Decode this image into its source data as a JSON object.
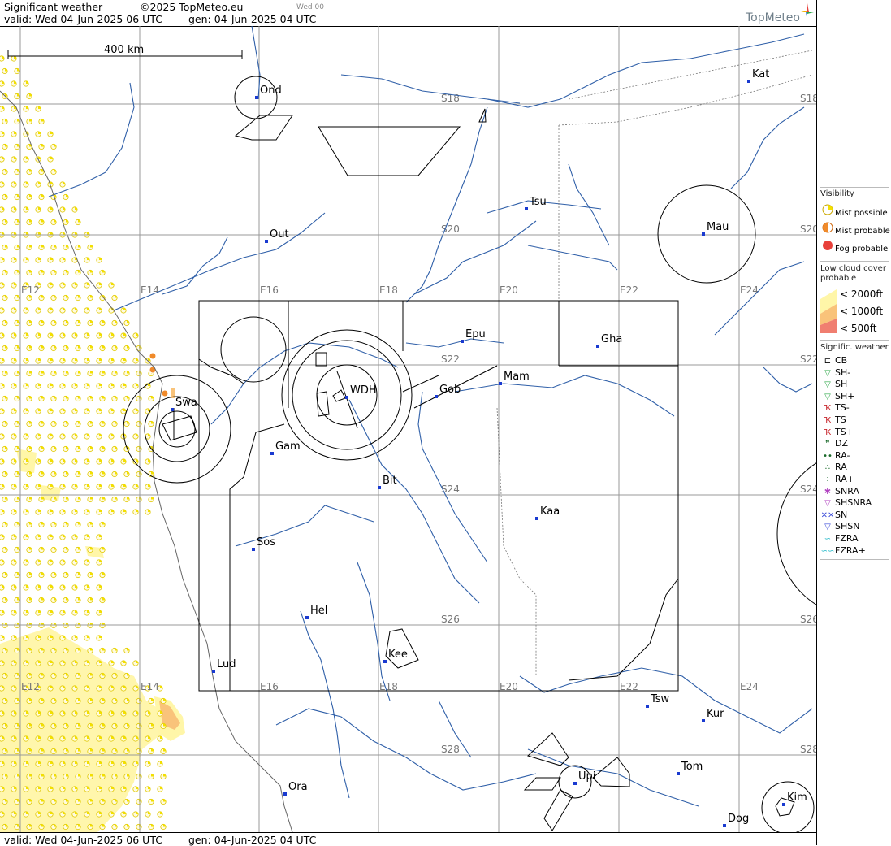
{
  "header": {
    "product": "Significant weather",
    "copyright": "©2025 TopMeteo.eu",
    "day_code": "Wed 00",
    "valid": "valid:  Wed  04-Jun-2025  06 UTC",
    "generated": "gen: 04-Jun-2025 04 UTC",
    "brand": "TopMeteo"
  },
  "footer": {
    "valid": "valid:  Wed  04-Jun-2025  06 UTC",
    "generated": "gen: 04-Jun-2025 04 UTC"
  },
  "map": {
    "scale_label": "400 km",
    "lat_labels": [
      "S18",
      "S20",
      "S22",
      "S24",
      "S26",
      "S28"
    ],
    "lon_labels": [
      "E12",
      "E14",
      "E16",
      "E18",
      "E20",
      "E22",
      "E24"
    ],
    "cities": [
      {
        "code": "Ond"
      },
      {
        "code": "Kat"
      },
      {
        "code": "Tsu"
      },
      {
        "code": "Out"
      },
      {
        "code": "Mau"
      },
      {
        "code": "Epu"
      },
      {
        "code": "Gha"
      },
      {
        "code": "Mam"
      },
      {
        "code": "Gob"
      },
      {
        "code": "WDH"
      },
      {
        "code": "Swa"
      },
      {
        "code": "Gam"
      },
      {
        "code": "Bit"
      },
      {
        "code": "Kaa"
      },
      {
        "code": "Sos"
      },
      {
        "code": "Hel"
      },
      {
        "code": "Kee"
      },
      {
        "code": "Lud"
      },
      {
        "code": "Tsw"
      },
      {
        "code": "Kur"
      },
      {
        "code": "Tom"
      },
      {
        "code": "Upi"
      },
      {
        "code": "Ora"
      },
      {
        "code": "Kim"
      },
      {
        "code": "Dog"
      }
    ]
  },
  "legend": {
    "visibility_title": "Visibility",
    "visibility": [
      "Mist possible",
      "Mist probable",
      "Fog probable"
    ],
    "low_cloud_title": "Low cloud cover probable",
    "low_cloud": [
      "< 2000ft",
      "< 1000ft",
      "<   500ft"
    ],
    "sigwx_title": "Signific. weather",
    "sigwx": [
      "CB",
      "SH-",
      "SH",
      "SH+",
      "TS-",
      "TS",
      "TS+",
      "DZ",
      "RA-",
      "RA",
      "RA+",
      "SNRA",
      "SHSNRA",
      "SN",
      "SHSN",
      "FZRA",
      "FZRA+"
    ],
    "colors": {
      "mist_possible": "#f3e000",
      "mist_probable": "#f08a2a",
      "fog_probable": "#e8403a",
      "cloud_2000": "#fff6a8",
      "cloud_1000": "#f9c37a",
      "cloud_500": "#f07e70",
      "river": "#2f5fa8",
      "grid": "#999999"
    }
  }
}
